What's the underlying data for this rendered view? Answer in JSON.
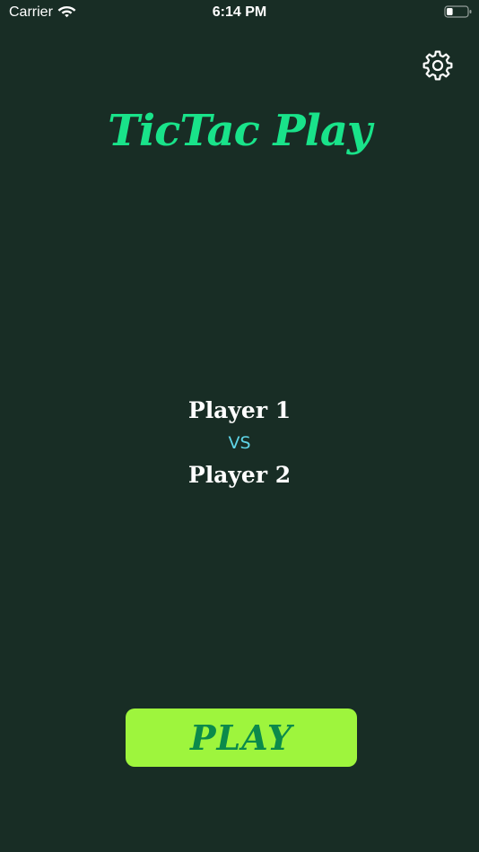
{
  "status_bar": {
    "carrier": "Carrier",
    "time": "6:14 PM",
    "wifi_icon": "wifi-icon",
    "battery_icon": "battery-icon",
    "battery_level": 0.3
  },
  "header": {
    "settings_icon": "gear-icon"
  },
  "title": "TicTac Play",
  "players": {
    "player1": "Player 1",
    "vs": "VS",
    "player2": "Player 2"
  },
  "play_button": {
    "label": "PLAY"
  },
  "colors": {
    "background": "#182d25",
    "title": "#19e38a",
    "vs": "#5fd5e8",
    "button_bg": "#9ef53d",
    "button_text": "#0b8a4b"
  }
}
